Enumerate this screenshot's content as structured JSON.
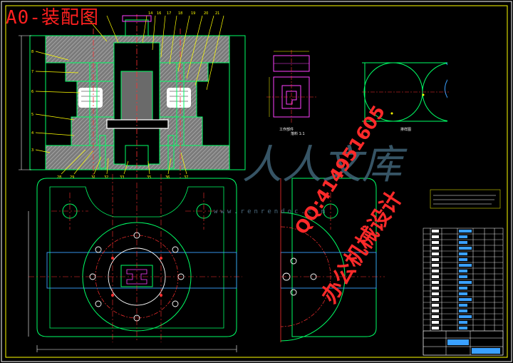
{
  "title": "A0-装配图",
  "watermark": {
    "logo": "人人文库",
    "domain": "www.renrendoc.com",
    "qq": "QQ:414951605",
    "brand": "办公机械设计"
  },
  "labels": {
    "detail_a": "工作部件",
    "detail_b": "落料 1:1",
    "detail_c": "排样图"
  },
  "colors": {
    "frame": "#ffff00",
    "outline": "#00ff66",
    "centerline": "#ff3030",
    "leader": "#ffff00",
    "section_gray": "#9a9a9a",
    "blue": "#3aa0ff",
    "magenta": "#ff40ff",
    "white": "#ffffff"
  }
}
